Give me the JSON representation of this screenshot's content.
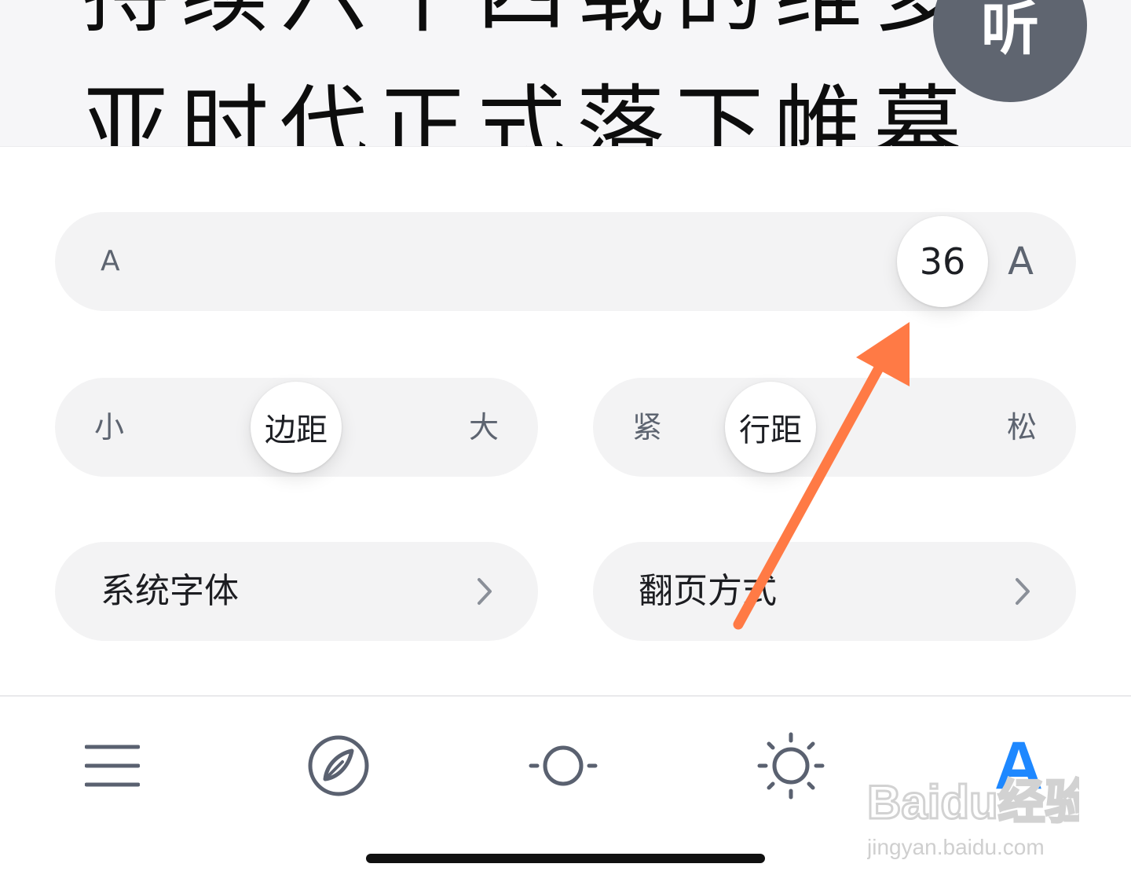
{
  "article": {
    "line1": "持续六十四载的维多",
    "line2": "亚时代正式落下帷幕"
  },
  "listen_button": {
    "label": "听"
  },
  "font_size": {
    "small_label": "A",
    "large_label": "A",
    "value": "36",
    "level": 0.87
  },
  "margin": {
    "left_label": "小",
    "knob_label": "边距",
    "right_label": "大",
    "level": 0.5
  },
  "line_spacing": {
    "left_label": "紧",
    "knob_label": "行距",
    "right_label": "松",
    "level": 0.3
  },
  "font_row": {
    "label": "系统字体"
  },
  "page_turn_row": {
    "label": "翻页方式"
  },
  "toolbar": {
    "items": [
      {
        "icon": "menu-icon"
      },
      {
        "icon": "compass-icon"
      },
      {
        "icon": "night-mode-icon"
      },
      {
        "icon": "brightness-icon"
      },
      {
        "icon": "font-settings-icon",
        "label": "A",
        "active": true
      }
    ],
    "active_color": "#1e88ff"
  },
  "colors": {
    "annotation_arrow": "#ff7a45",
    "listen_button_bg": "#5f6570",
    "pill_bg": "#f3f3f4"
  },
  "watermark": {
    "brand": "Baidu经验",
    "url": "jingyan.baidu.com"
  }
}
